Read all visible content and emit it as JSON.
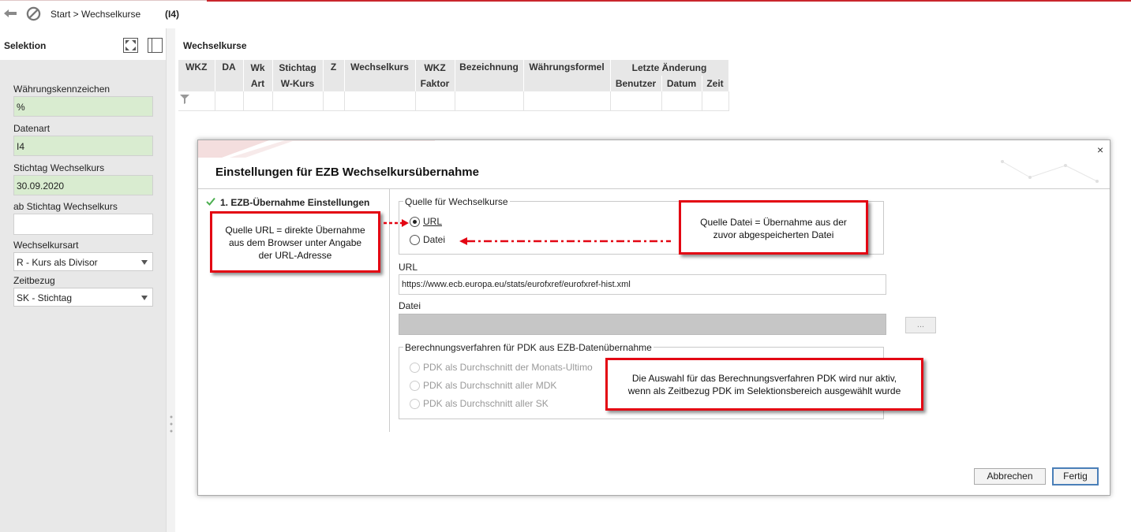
{
  "topbar": {
    "breadcrumb": "Start > Wechselkurse",
    "code": "(I4)",
    "back_icon": "back-arrow-icon",
    "cancel_icon": "ban-icon"
  },
  "left": {
    "title": "Selektion",
    "fields": {
      "waehrung_label": "Währungskennzeichen",
      "waehrung_value": "%",
      "datenart_label": "Datenart",
      "datenart_value": "I4",
      "stichtag_label": "Stichtag Wechselkurs",
      "stichtag_value": "30.09.2020",
      "ab_stichtag_label": "ab Stichtag Wechselkurs",
      "ab_stichtag_value": "",
      "kursart_label": "Wechselkursart",
      "kursart_value": "R -  Kurs als Divisor",
      "zeitbezug_label": "Zeitbezug",
      "zeitbezug_value": "SK -  Stichtag"
    }
  },
  "main": {
    "title": "Wechselkurse",
    "columns": {
      "wkz": "WKZ",
      "da": "DA",
      "wk_art_1": "Wk",
      "wk_art_2": "Art",
      "stichtag_1": "Stichtag",
      "stichtag_2": "W-Kurs",
      "z": "Z",
      "wechselkurs": "Wechselkurs",
      "wkz_faktor_1": "WKZ",
      "wkz_faktor_2": "Faktor",
      "bezeichnung": "Bezeichnung",
      "formel": "Währungsformel",
      "letzte": "Letzte Änderung",
      "benutzer": "Benutzer",
      "datum": "Datum",
      "zeit": "Zeit"
    }
  },
  "dialog": {
    "title": "Einstellungen für EZB Wechselkursübernahme",
    "close": "×",
    "step": "1. EZB-Übernahme Einstellungen",
    "quelle_legend": "Quelle für Wechselkurse",
    "radio_url": "URL",
    "radio_datei": "Datei",
    "url_label": "URL",
    "url_value": "https://www.ecb.europa.eu/stats/eurofxref/eurofxref-hist.xml",
    "datei_label": "Datei",
    "browse": "...",
    "berechnung_legend": "Berechnungsverfahren für PDK aus EZB-Datenübernahme",
    "opt1": "PDK als Durchschnitt der Monats-Ultimo",
    "opt2": "PDK als Durchschnitt aller MDK",
    "opt3": "PDK als Durchschnitt aller SK",
    "cancel": "Abbrechen",
    "finish": "Fertig"
  },
  "annotations": {
    "url_note_1": "Quelle URL = direkte Übernahme",
    "url_note_2": "aus dem Browser unter Angabe",
    "url_note_3": "der URL-Adresse",
    "datei_note_1": "Quelle Datei = Übernahme aus der",
    "datei_note_2": "zuvor abgespeicherten Datei",
    "pdk_note_1": "Die Auswahl für das Berechnungsverfahren PDK wird nur aktiv,",
    "pdk_note_2": "wenn als Zeitbezug PDK im Selektionsbereich ausgewählt wurde"
  },
  "colors": {
    "accent_red": "#c9262c",
    "callout_red": "#e30613",
    "field_green": "#d9ecd0",
    "primary_button": "#4a7fb8"
  }
}
